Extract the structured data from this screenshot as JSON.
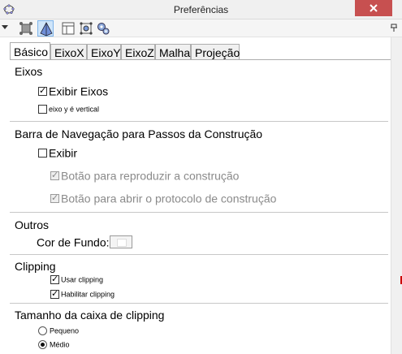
{
  "window": {
    "title": "Preferências",
    "close_symbol": "×"
  },
  "toolbar": {
    "buttons": [
      {
        "icon": "graphics-settings-icon"
      },
      {
        "icon": "3d-graphics-icon"
      },
      {
        "icon": "layout-icon"
      },
      {
        "icon": "defaults-icon"
      },
      {
        "icon": "advanced-settings-icon"
      }
    ]
  },
  "tabs": [
    {
      "label": "Básico",
      "active": true
    },
    {
      "label": "EixoX"
    },
    {
      "label": "EixoY"
    },
    {
      "label": "EixoZ"
    },
    {
      "label": "Malha"
    },
    {
      "label": "Projeção"
    }
  ],
  "sections": {
    "eixos": {
      "title": "Eixos",
      "show_axes": {
        "label": "Exibir Eixos",
        "checked": true
      },
      "y_vertical": {
        "label": "eixo y é vertical",
        "checked": false
      }
    },
    "nav": {
      "title": "Barra de Navegação para Passos da Construção",
      "show": {
        "label": "Exibir",
        "checked": false
      },
      "play_button": {
        "label": "Botão para reproduzir a construção",
        "checked": true,
        "enabled": false
      },
      "protocol_button": {
        "label": "Botão para abrir o protocolo de construção",
        "checked": true,
        "enabled": false
      }
    },
    "outros": {
      "title": "Outros",
      "background_label": "Cor de Fundo:"
    },
    "clipping": {
      "title": "Clipping",
      "use": {
        "label": "Usar clipping",
        "checked": true
      },
      "enable": {
        "label": "Habilitar clipping",
        "checked": true
      }
    },
    "clip_size": {
      "title": "Tamanho da caixa de clipping",
      "options": [
        {
          "label": "Pequeno",
          "selected": false
        },
        {
          "label": "Médio",
          "selected": true
        }
      ]
    }
  }
}
